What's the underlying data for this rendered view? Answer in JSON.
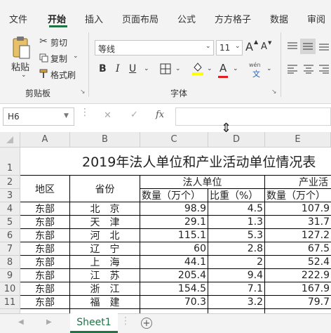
{
  "tabs": [
    "文件",
    "开始",
    "插入",
    "页面布局",
    "公式",
    "方方格子",
    "数据",
    "审阅"
  ],
  "clipboard": {
    "paste": "粘贴",
    "cut": "剪切",
    "copy": "复制",
    "format_painter": "格式刷",
    "group_label": "剪贴板"
  },
  "font": {
    "name": "等线",
    "size": "11",
    "increase": "A",
    "decrease": "A",
    "bold": "B",
    "italic": "I",
    "underline": "U",
    "font_color": "A",
    "phonetic_top": "wén",
    "phonetic_char": "文",
    "group_label": "字体"
  },
  "formula_bar": {
    "name_box": "H6",
    "cancel": "✕",
    "enter": "✓",
    "fx": "fx",
    "content": ""
  },
  "columns": [
    "A",
    "B",
    "C",
    "D",
    "E"
  ],
  "rows": [
    "1",
    "2",
    "3",
    "4",
    "5",
    "6",
    "7",
    "8",
    "9",
    "10",
    "11"
  ],
  "sheet": {
    "title": "2019年法人单位和产业活动单位情况表",
    "header_region": "地区",
    "header_province": "省份",
    "header_legal": "法人单位",
    "header_industry": "产业活",
    "sub_count": "数量（万个）",
    "sub_ratio": "比重（%）",
    "sub_count2": "数量（万个）",
    "data": [
      [
        "东部",
        "北　京",
        "98.9",
        "4.5",
        "107.9"
      ],
      [
        "东部",
        "天　津",
        "29.1",
        "1.3",
        "31.7"
      ],
      [
        "东部",
        "河　北",
        "115.1",
        "5.3",
        "127.2"
      ],
      [
        "东部",
        "辽　宁",
        "60",
        "2.8",
        "67.5"
      ],
      [
        "东部",
        "上　海",
        "44.1",
        "2",
        "52.4"
      ],
      [
        "东部",
        "江　苏",
        "205.4",
        "9.4",
        "222.9"
      ],
      [
        "东部",
        "浙　江",
        "154.5",
        "7.1",
        "167.9"
      ],
      [
        "东部",
        "福　建",
        "70.3",
        "3.2",
        "79.7"
      ]
    ]
  },
  "sheet_tab": "Sheet1",
  "add_sheet": "+"
}
